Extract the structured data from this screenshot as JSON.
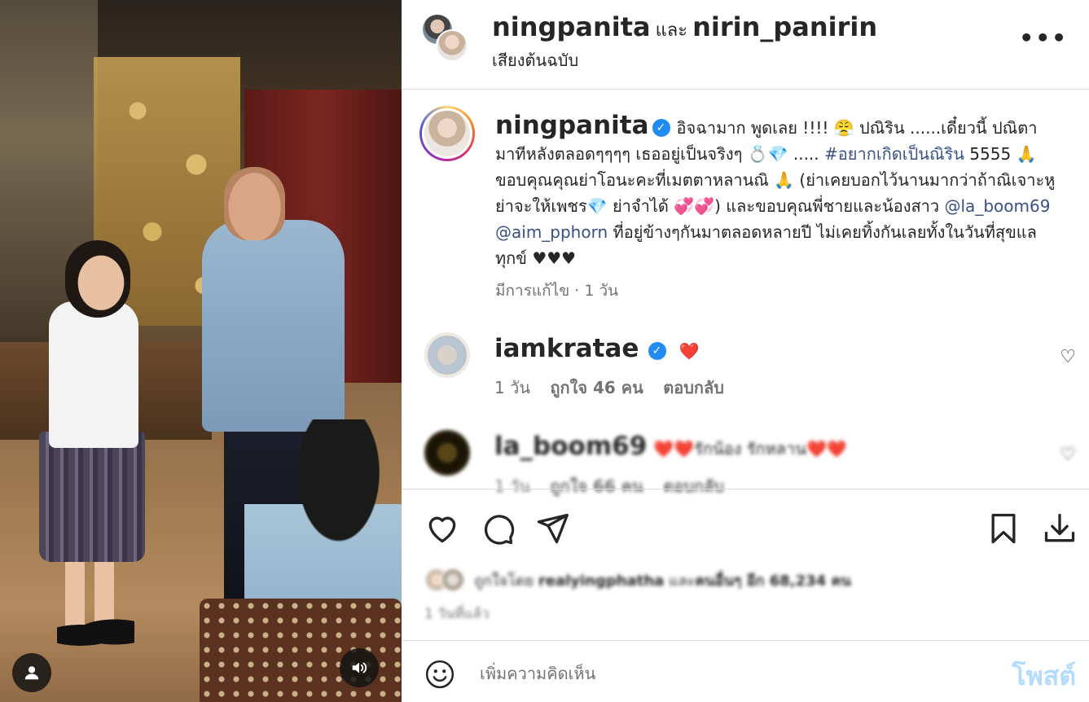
{
  "header": {
    "user1": "ningpanita",
    "conj": "และ",
    "user2": "nirin_panirin",
    "audio": "เสียงต้นฉบับ",
    "more_icon": "more-horizontal-icon"
  },
  "caption": {
    "username": "ningpanita",
    "verified": true,
    "part1": "อิจฉามาก พูดเลย !!!! 😤 ปณิริน ......เดี๋ยวนี้ ปณิตา มาทีหลังตลอดๆๆๆๆ เธออยู่เป็นจริงๆ 💍💎 .....",
    "hashtag": "#อยากเกิดเป็นณิริน",
    "part2": "5555 🙏 ขอบคุณคุณย่าโอนะคะที่เมตตาหลานณิ 🙏 (ย่าเคยบอกไว้นานมากว่าถ้าณิเจาะหูย่าจะให้เพชร💎 ย่าจำได้ 💞💞) และขอบคุณพี่ชายและน้องสาว",
    "mention1": "@la_boom69",
    "mention2": "@aim_pphorn",
    "part3": "ที่อยู่ข้างๆกันมาตลอดหลายปี ไม่เคยทิ้งกันเลยทั้งในวันที่สุขแลทุกข์ ♥♥♥",
    "meta": "มีการแก้ไข · 1 วัน"
  },
  "comments": [
    {
      "username": "iamkratae",
      "verified": true,
      "text": "❤️",
      "time": "1 วัน",
      "likes": "ถูกใจ 46 คน",
      "reply": "ตอบกลับ"
    },
    {
      "username": "la_boom69",
      "verified": false,
      "text": "❤️❤️รักน้อง รักหลาน❤️❤️",
      "time": "1 วัน",
      "likes": "ถูกใจ 66 คน",
      "reply": "ตอบกลับ"
    }
  ],
  "actions": {
    "like_icon": "heart-icon",
    "comment_icon": "comment-icon",
    "share_icon": "send-icon",
    "save_icon": "bookmark-icon",
    "download_icon": "download-icon"
  },
  "likes": {
    "prefix": "ถูกใจโดย",
    "user": "realyingphatha",
    "middle": "และ",
    "others": "คนอื่นๆ อีก 68,234 คน"
  },
  "time_ago": "1 วันที่แล้ว",
  "comment_box": {
    "placeholder": "เพิ่มความคิดเห็น",
    "post_label": "โพสต์"
  },
  "media": {
    "user_icon": "user-icon",
    "sound_icon": "speaker-icon"
  },
  "colors": {
    "link": "#385185",
    "verified": "#1f8bf3",
    "post_disabled": "#b3dbff",
    "secondary_text": "#737373"
  }
}
